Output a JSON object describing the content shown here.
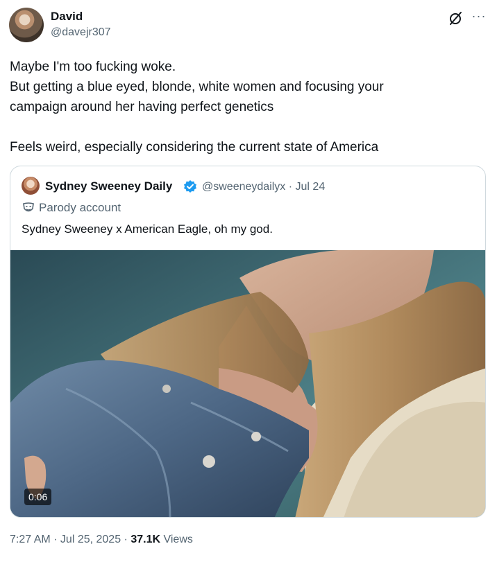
{
  "author": {
    "name": "David",
    "handle": "@davejr307",
    "avatar_icon": "profile-photo"
  },
  "tweet": {
    "lines": [
      "Maybe I'm too fucking woke.",
      "But getting a blue eyed, blonde, white women and focusing your",
      "campaign around her having perfect genetics",
      "",
      "Feels weird, especially considering the current state of America"
    ]
  },
  "quote": {
    "name": "Sydney Sweeney Daily",
    "verified": true,
    "verified_color": "#1d9bf0",
    "meta": "@sweeneydailyx · Jul 24",
    "parody_label": "Parody account",
    "text": "Sydney Sweeney x American Eagle, oh my god.",
    "media": {
      "type": "video",
      "duration": "0:06"
    }
  },
  "footer": {
    "timestamp": "7:27 AM · Jul 25, 2025 · ",
    "views_count": "37.1K",
    "views_label": " Views"
  },
  "icons": {
    "grok": "grok-icon",
    "more": "more-options-icon",
    "parody": "parody-mask-icon",
    "verified": "verified-badge-icon"
  }
}
